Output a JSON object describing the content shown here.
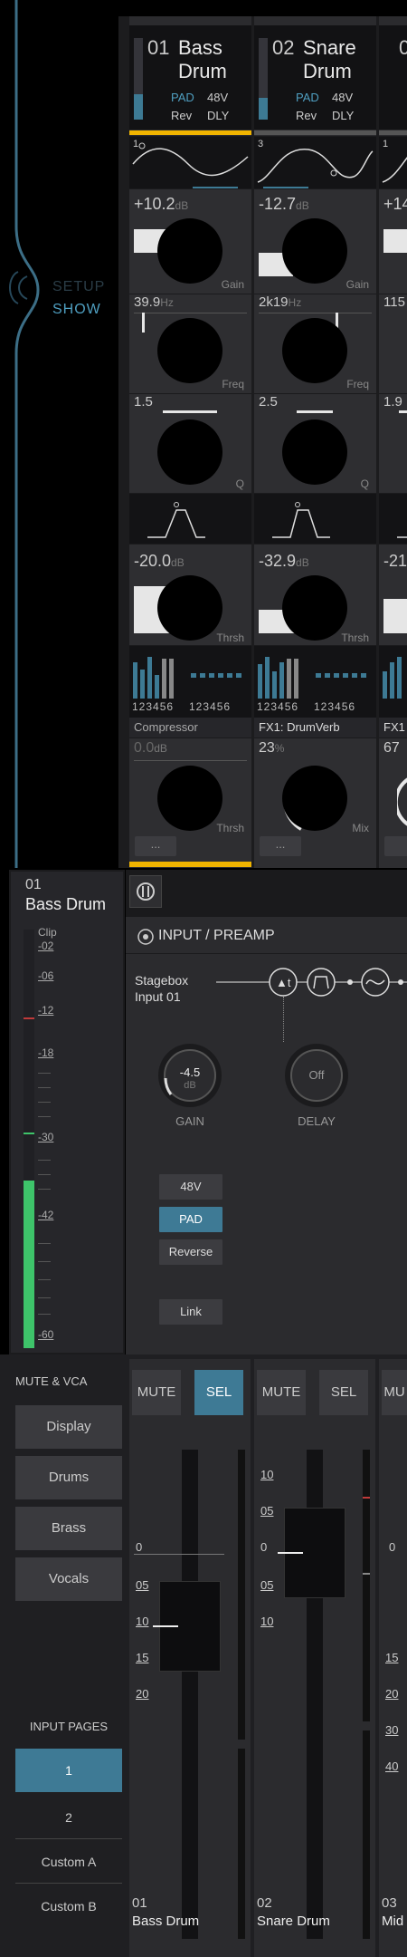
{
  "nav": {
    "setup": "SETUP",
    "show": "SHOW"
  },
  "channels": [
    {
      "num": "01",
      "name1": "Bass",
      "name2": "Drum",
      "pad": "PAD",
      "v48": "48V",
      "rev": "Rev",
      "dly": "DLY",
      "eqband": "1",
      "gain": "+10.2",
      "gain_unit": "dB",
      "gain_lbl": "Gain",
      "freq": "39.9",
      "freq_unit": "Hz",
      "freq_lbl": "Freq",
      "q": "1.5",
      "q_lbl": "Q",
      "thresh": "-20.0",
      "thresh_unit": "dB",
      "thresh_lbl": "Thrsh",
      "mini": "123456",
      "mini2": "123456",
      "dyn_name": "Compressor",
      "dyn_val": "0.0",
      "dyn_unit": "dB",
      "dyn_lbl": "Thrsh",
      "more": "..."
    },
    {
      "num": "02",
      "name1": "Snare",
      "name2": "Drum",
      "pad": "PAD",
      "v48": "48V",
      "rev": "Rev",
      "dly": "DLY",
      "eqband": "3",
      "gain": "-12.7",
      "gain_unit": "dB",
      "gain_lbl": "Gain",
      "freq": "2k19",
      "freq_unit": "Hz",
      "freq_lbl": "Freq",
      "q": "2.5",
      "q_lbl": "Q",
      "thresh": "-32.9",
      "thresh_unit": "dB",
      "thresh_lbl": "Thrsh",
      "mini": "123456",
      "mini2": "123456",
      "dyn_name": "FX1: DrumVerb",
      "dyn_val": "23",
      "dyn_unit": "%",
      "dyn_lbl": "Mix",
      "more": "..."
    },
    {
      "num": "0",
      "eqband": "1",
      "gain": "+14",
      "freq": "115",
      "q": "1.9",
      "thresh": "-21",
      "dyn_name": "FX1",
      "dyn_val": "67"
    }
  ],
  "selected": {
    "num": "01",
    "name": "Bass Drum",
    "scale": [
      "Clip",
      "-02",
      "-06",
      "-12",
      "-18",
      "-30",
      "-42",
      "-60"
    ],
    "meter_level": 0.4
  },
  "preamp": {
    "title": "INPUT / PREAMP",
    "source1": "Stagebox",
    "source2": "Input 01",
    "gain_val": "-4.5",
    "gain_unit": "dB",
    "gain_lbl": "GAIN",
    "delay_val": "Off",
    "delay_lbl": "DELAY",
    "btn_48v": "48V",
    "btn_pad": "PAD",
    "btn_reverse": "Reverse",
    "btn_link": "Link"
  },
  "mute_vca": {
    "title": "MUTE & VCA",
    "items": [
      "Display",
      "Drums",
      "Brass",
      "Vocals"
    ]
  },
  "input_pages": {
    "title": "INPUT PAGES",
    "items": [
      "1",
      "2",
      "Custom A",
      "Custom B"
    ]
  },
  "faders": [
    {
      "mute": "MUTE",
      "sel": "SEL",
      "num": "01",
      "name": "Bass Drum",
      "scale": [
        "0",
        "05",
        "10",
        "15",
        "20"
      ]
    },
    {
      "mute": "MUTE",
      "sel": "SEL",
      "num": "02",
      "name": "Snare Drum",
      "scale": [
        "10",
        "05",
        "0",
        "05",
        "10"
      ]
    },
    {
      "mute": "MU",
      "num": "03",
      "name": "Mid",
      "scale": [
        "0",
        "15",
        "20",
        "30",
        "40"
      ]
    }
  ]
}
